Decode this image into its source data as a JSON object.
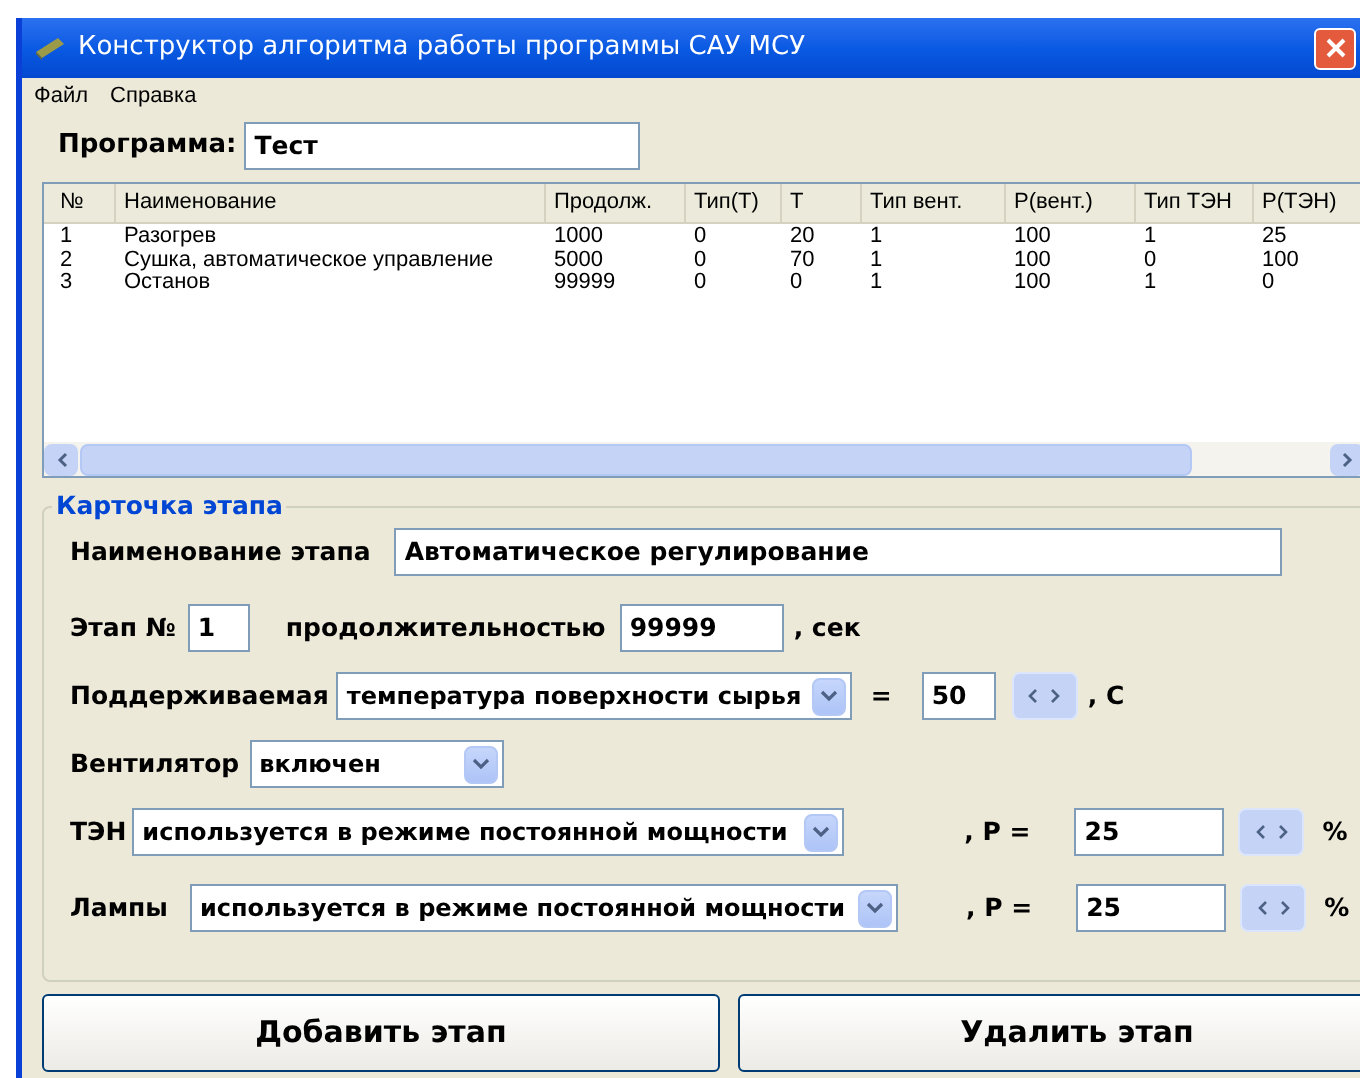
{
  "window": {
    "title": "Конструктор алгоритма работы программы САУ МСУ"
  },
  "menu": [
    "Файл",
    "Справка"
  ],
  "program": {
    "label": "Программа:",
    "value": "Тест"
  },
  "table": {
    "columns": [
      "№",
      "Наименование",
      "Продолж.",
      "Тип(Т)",
      "Т",
      "Тип вент.",
      "Р(вент.)",
      "Тип ТЭН",
      "Р(ТЭН)"
    ],
    "rows": [
      [
        "1",
        "Разогрев",
        "1000",
        "0",
        "20",
        "1",
        "100",
        "1",
        "25"
      ],
      [
        "2",
        "Сушка, автоматическое управление",
        "5000",
        "0",
        "70",
        "1",
        "100",
        "0",
        "100"
      ],
      [
        "3",
        "Останов",
        "99999",
        "0",
        "0",
        "1",
        "100",
        "1",
        "0"
      ]
    ]
  },
  "stage_card": {
    "title": "Карточка этапа",
    "name": {
      "label": "Наименование этапа",
      "value": "Автоматическое регулирование"
    },
    "number": {
      "label": "Этап №",
      "value": "1"
    },
    "duration": {
      "label": "продолжительностью",
      "value": "99999",
      "unit": ", сек"
    },
    "maintained": {
      "label": "Поддерживаемая",
      "value": "температура поверхности сырья",
      "equals": "=",
      "setpoint": "50",
      "unit": ", С"
    },
    "fan": {
      "label": "Вентилятор",
      "value": "включен"
    },
    "heater": {
      "label": "ТЭН",
      "value": "используется в режиме постоянной мощности",
      "p_label": ", P =",
      "p_value": "25",
      "unit": "%"
    },
    "lamps": {
      "label": "Лампы",
      "value": "используется в режиме постоянной мощности",
      "p_label": ", P =",
      "p_value": "25",
      "unit": "%"
    }
  },
  "buttons": [
    "Добавить этап",
    "Удалить этап"
  ]
}
